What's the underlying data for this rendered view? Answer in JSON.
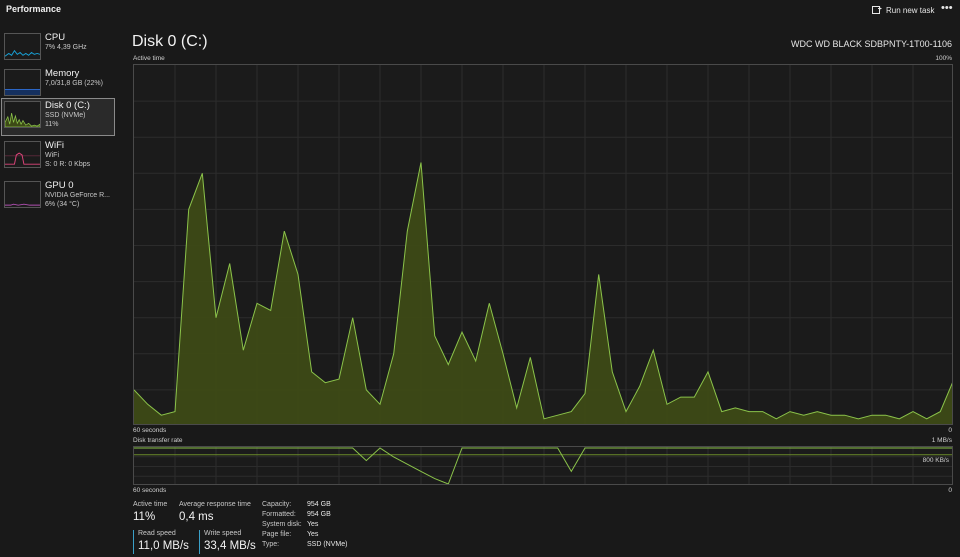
{
  "app": {
    "title": "Performance"
  },
  "toolbar": {
    "run_new_task": "Run new task",
    "more": "•••"
  },
  "sidebar": {
    "items": [
      {
        "name": "CPU",
        "sub1": "7% 4,39 GHz",
        "sub2": "",
        "color": "#17a2d8"
      },
      {
        "name": "Memory",
        "sub1": "7,0/31,8 GB (22%)",
        "sub2": "",
        "color": "#2f6fd6"
      },
      {
        "name": "Disk 0 (C:)",
        "sub1": "SSD (NVMe)",
        "sub2": "11%",
        "color": "#8bc34a"
      },
      {
        "name": "WiFi",
        "sub1": "WiFi",
        "sub2": "S: 0 R: 0 Kbps",
        "color": "#e0457b"
      },
      {
        "name": "GPU 0",
        "sub1": "NVIDIA GeForce R...",
        "sub2": "6% (34 °C)",
        "color": "#b04fb0"
      }
    ]
  },
  "main": {
    "title": "Disk 0 (C:)",
    "model": "WDC WD BLACK SDBPNTY-1T00-1106"
  },
  "active_graph": {
    "label": "Active time",
    "max_label": "100%",
    "time_label": "60 seconds",
    "min_label": "0",
    "color": "#8bc34a",
    "fill": "#3d4a16",
    "values": [
      10,
      6,
      3,
      4,
      60,
      70,
      30,
      45,
      21,
      34,
      32,
      54,
      42,
      15,
      12,
      13,
      30,
      10,
      6,
      20,
      54,
      73,
      25,
      17,
      26,
      18,
      34,
      20,
      5,
      19,
      2,
      3,
      4,
      9,
      42,
      15,
      4,
      11,
      21,
      6,
      8,
      8,
      15,
      4,
      5,
      4,
      4,
      2,
      4,
      3,
      4,
      3,
      3,
      2,
      3,
      3,
      2,
      4,
      2,
      4,
      13
    ]
  },
  "transfer_graph": {
    "label": "Disk transfer rate",
    "max_label": "1 MB/s",
    "ref_label": "800 KB/s",
    "time_label": "60 seconds",
    "min_label": "0",
    "read_color": "#8bc34a",
    "write_color": "#8bc34a",
    "write_values": [
      100,
      100,
      100,
      100,
      100,
      100,
      100,
      100,
      100,
      100,
      100,
      100,
      100,
      100,
      100,
      100,
      100,
      65,
      100,
      75,
      55,
      35,
      15,
      0,
      100,
      100,
      100,
      100,
      100,
      100,
      100,
      100,
      35,
      100,
      100,
      100,
      100,
      100,
      100,
      100,
      100,
      100,
      100,
      100,
      100,
      100,
      100,
      100,
      100,
      100,
      100,
      100,
      100,
      100,
      100,
      100,
      100,
      100,
      100,
      100,
      100
    ],
    "read_values": [
      0,
      0,
      0,
      0,
      0,
      0,
      0,
      0,
      0,
      0,
      0,
      0,
      0,
      0,
      0,
      0,
      0,
      0,
      0,
      0,
      0,
      0,
      0,
      0,
      0,
      0,
      0,
      0,
      0,
      0,
      0,
      0,
      0,
      0,
      0,
      0,
      0,
      0,
      0,
      0,
      0,
      0,
      0,
      0,
      0,
      0,
      0,
      0,
      0,
      0,
      0,
      0,
      0,
      0,
      0,
      0,
      0,
      0,
      0,
      0,
      0
    ]
  },
  "stats": {
    "active_time_label": "Active time",
    "active_time_value": "11%",
    "response_label": "Average response time",
    "response_value": "0,4 ms",
    "read_label": "Read speed",
    "read_value": "11,0 MB/s",
    "write_label": "Write speed",
    "write_value": "33,4 MB/s",
    "read_color": "#3aa0c8",
    "write_color": "#3aa0c8"
  },
  "properties": [
    {
      "key": "Capacity:",
      "value": "954 GB"
    },
    {
      "key": "Formatted:",
      "value": "954 GB"
    },
    {
      "key": "System disk:",
      "value": "Yes"
    },
    {
      "key": "Page file:",
      "value": "Yes"
    },
    {
      "key": "Type:",
      "value": "SSD (NVMe)"
    }
  ]
}
